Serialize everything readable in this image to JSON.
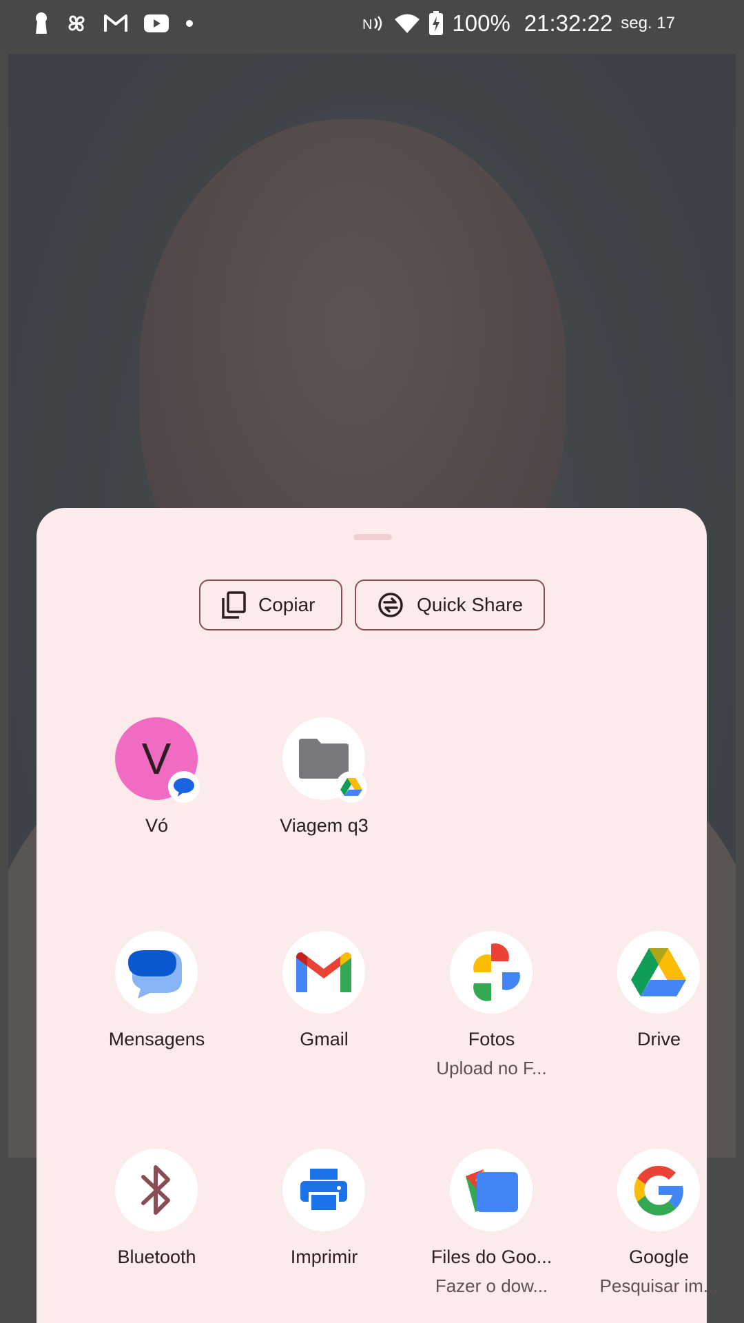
{
  "status_bar": {
    "battery": "100%",
    "time": "21:32:22",
    "date": "seg. 17",
    "icons": [
      "keyhole-icon",
      "pinwheel-icon",
      "gmail-icon",
      "youtube-icon",
      "dot-icon",
      "nfc-icon",
      "wifi-icon",
      "battery-charging-icon"
    ]
  },
  "actions": {
    "copy": "Copiar",
    "quick_share": "Quick Share"
  },
  "shortcuts": [
    {
      "label": "Vó",
      "initial": "V",
      "icon": "contact-avatar",
      "badge": "messages-icon"
    },
    {
      "label": "Viagem q3",
      "icon": "folder-icon",
      "badge": "drive-icon"
    }
  ],
  "apps_row1": [
    {
      "label": "Mensagens",
      "sub": "",
      "icon": "messages-icon"
    },
    {
      "label": "Gmail",
      "sub": "",
      "icon": "gmail-icon"
    },
    {
      "label": "Fotos",
      "sub": "Upload no F...",
      "icon": "photos-icon"
    },
    {
      "label": "Drive",
      "sub": "",
      "icon": "drive-icon"
    }
  ],
  "apps_row2": [
    {
      "label": "Bluetooth",
      "sub": "",
      "icon": "bluetooth-icon"
    },
    {
      "label": "Imprimir",
      "sub": "",
      "icon": "print-icon"
    },
    {
      "label": "Files do Goo...",
      "sub": "Fazer o dow...",
      "icon": "files-icon"
    },
    {
      "label": "Google",
      "sub": "Pesquisar im...",
      "icon": "google-icon"
    }
  ],
  "colors": {
    "sheet_bg": "#fbeceb",
    "chip_border": "#8a4d55",
    "avatar_pink": "#f06bc2"
  }
}
